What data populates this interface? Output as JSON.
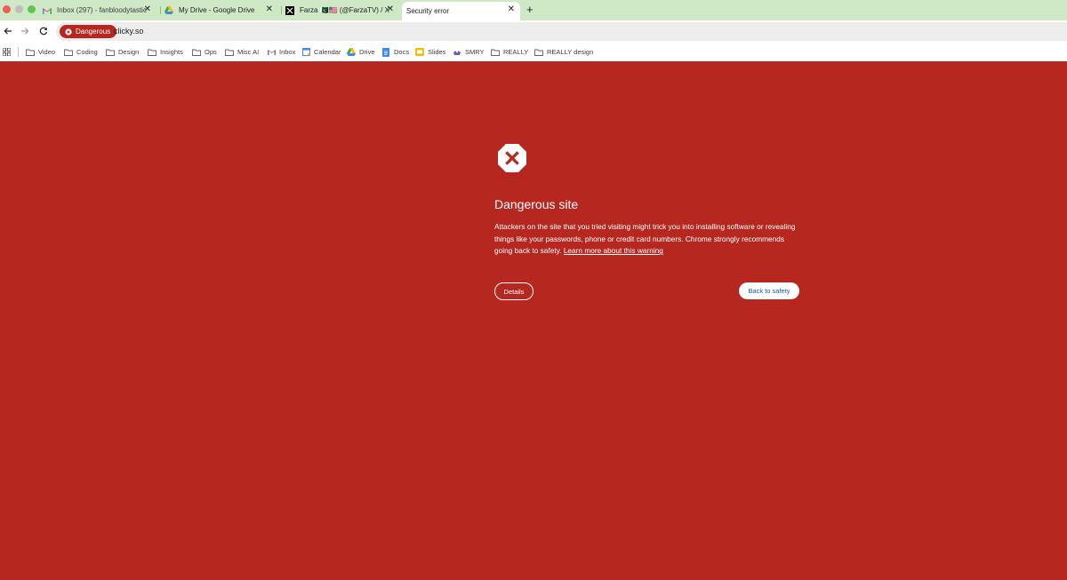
{
  "tabs": [
    {
      "title": "Inbox (297) - fanbloodytastic",
      "icon": "gmail-icon"
    },
    {
      "title": "My Drive - Google Drive",
      "icon": "drive-icon"
    },
    {
      "title": "Farza 🇵🇰🇺🇸 (@FarzaTV) / X",
      "icon": "x-icon"
    },
    {
      "title": "Security error",
      "icon": null
    }
  ],
  "toolbar": {
    "security_chip": "Dangerous",
    "url": "clicky.so"
  },
  "bookmarks": [
    {
      "label": "Video",
      "icon": "folder-icon"
    },
    {
      "label": "Coding",
      "icon": "folder-icon"
    },
    {
      "label": "Design",
      "icon": "folder-icon"
    },
    {
      "label": "Insights",
      "icon": "folder-icon"
    },
    {
      "label": "Ops",
      "icon": "folder-icon"
    },
    {
      "label": "Misc AI",
      "icon": "folder-icon"
    },
    {
      "label": "Inbox",
      "icon": "gmail-icon"
    },
    {
      "label": "Calendar",
      "icon": "calendar-icon"
    },
    {
      "label": "Drive",
      "icon": "drive-icon"
    },
    {
      "label": "Docs",
      "icon": "docs-icon"
    },
    {
      "label": "Slides",
      "icon": "slides-icon"
    },
    {
      "label": "SMRY",
      "icon": "smry-icon"
    },
    {
      "label": "REALLY",
      "icon": "folder-icon"
    },
    {
      "label": "REALLY design",
      "icon": "folder-icon"
    }
  ],
  "interstitial": {
    "heading": "Dangerous site",
    "body": "Attackers on the site that you tried visiting might trick you into installing software or revealing things like your passwords, phone or credit card numbers. Chrome strongly recommends going back to safety.",
    "learn_more": "Learn more about this warning",
    "details_button": "Details",
    "back_button": "Back to safety"
  },
  "colors": {
    "danger_red": "#b62720",
    "tabstrip_green": "#cfe8c6",
    "link_blue": "#1a56c4"
  }
}
